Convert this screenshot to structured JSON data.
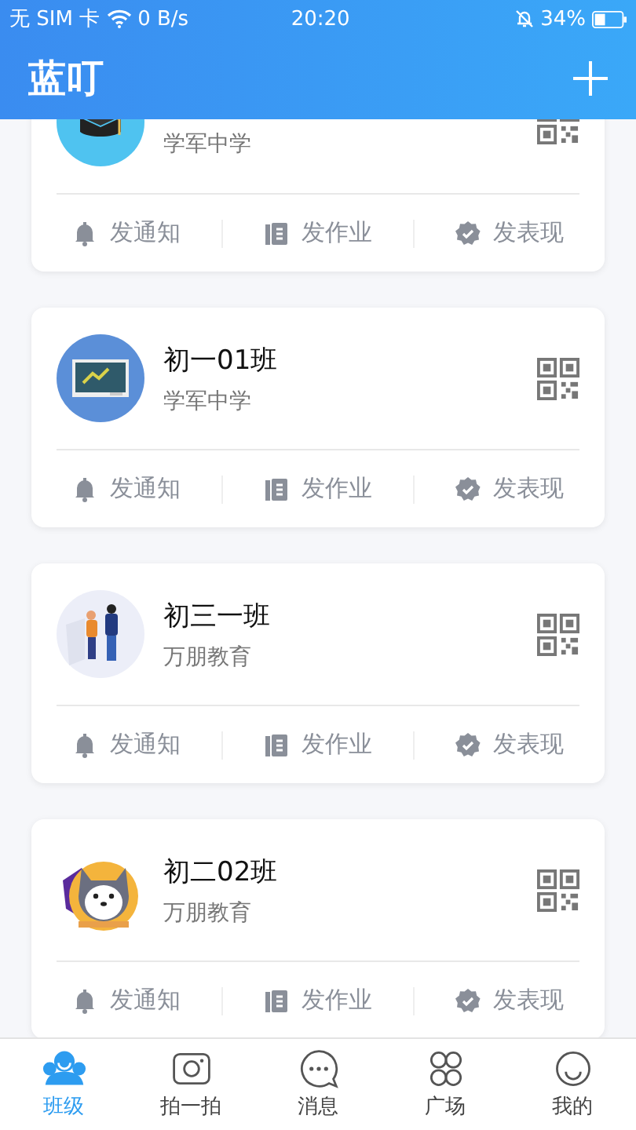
{
  "status_bar": {
    "carrier": "无 SIM 卡",
    "speed": "0 B/s",
    "time": "20:20",
    "battery": "34%"
  },
  "header": {
    "logo": "蓝叮"
  },
  "classes": [
    {
      "kind": "cap",
      "school": "学军中学",
      "cut": true,
      "actions": [
        "发通知",
        "发作业",
        "发表现"
      ]
    },
    {
      "kind": "board",
      "name": "初一01班",
      "school": "学军中学",
      "cut": false,
      "actions": [
        "发通知",
        "发作业",
        "发表现"
      ]
    },
    {
      "kind": "people",
      "name": "初三一班",
      "school": "万朋教育",
      "cut": false,
      "actions": [
        "发通知",
        "发作业",
        "发表现"
      ]
    },
    {
      "kind": "mascot",
      "name": "初二02班",
      "school": "万朋教育",
      "cut": false,
      "actions": [
        "发通知",
        "发作业",
        "发表现"
      ]
    }
  ],
  "tabs": [
    {
      "label": "班级",
      "selected": true
    },
    {
      "label": "拍一拍",
      "selected": false
    },
    {
      "label": "消息",
      "selected": false
    },
    {
      "label": "广场",
      "selected": false
    },
    {
      "label": "我的",
      "selected": false
    }
  ]
}
